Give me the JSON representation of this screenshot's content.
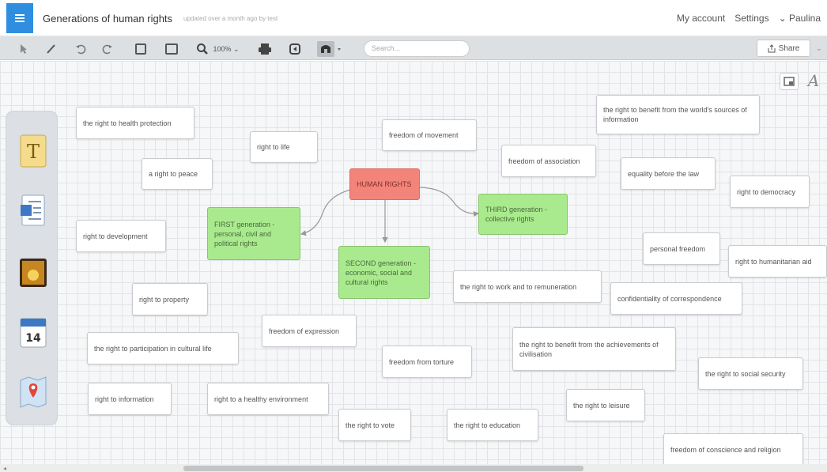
{
  "header": {
    "title": "Generations of human rights",
    "meta": "updated over a month ago by test",
    "my_account": "My account",
    "settings": "Settings",
    "user": "⌄ Paulina"
  },
  "toolbar": {
    "zoom": "100% ⌄",
    "search_placeholder": "Search...",
    "share": "Share",
    "more": "⌄"
  },
  "dock": {
    "items": [
      "text-icon",
      "word-document-icon",
      "image-icon",
      "calendar-icon",
      "map-pin-icon"
    ],
    "calendar_day": "14",
    "text_glyph": "T"
  },
  "right_tools": {
    "style_glyph": "A"
  },
  "mindmap": {
    "center": "HUMAN RIGHTS",
    "first": "FIRST generation - personal, civil and political rights",
    "second": "SECOND generation - economic, social and cultural rights",
    "third": "THIRD generation - collective rights",
    "rights": [
      "the right to health protection",
      "right to life",
      "a right to peace",
      "right to development",
      "right to property",
      "the right to participation in cultural life",
      "right to information",
      "right to a healthy environment",
      "freedom of expression",
      "the right to vote",
      "freedom from torture",
      "the right to education",
      "freedom of movement",
      "freedom of association",
      "the right to work and to remuneration",
      "the right to benefit from the world's sources of information",
      "equality before the law",
      "right to democracy",
      "personal freedom",
      "right to humanitarian aid",
      "confidentiality of correspondence",
      "the right to benefit from the achievements of civilisation",
      "the right to social security",
      "the right to leisure",
      "freedom of conscience and religion"
    ]
  },
  "colors": {
    "accent": "#2f8ee0",
    "center_node": "#f3847a",
    "generation_node": "#a9ea8e"
  }
}
